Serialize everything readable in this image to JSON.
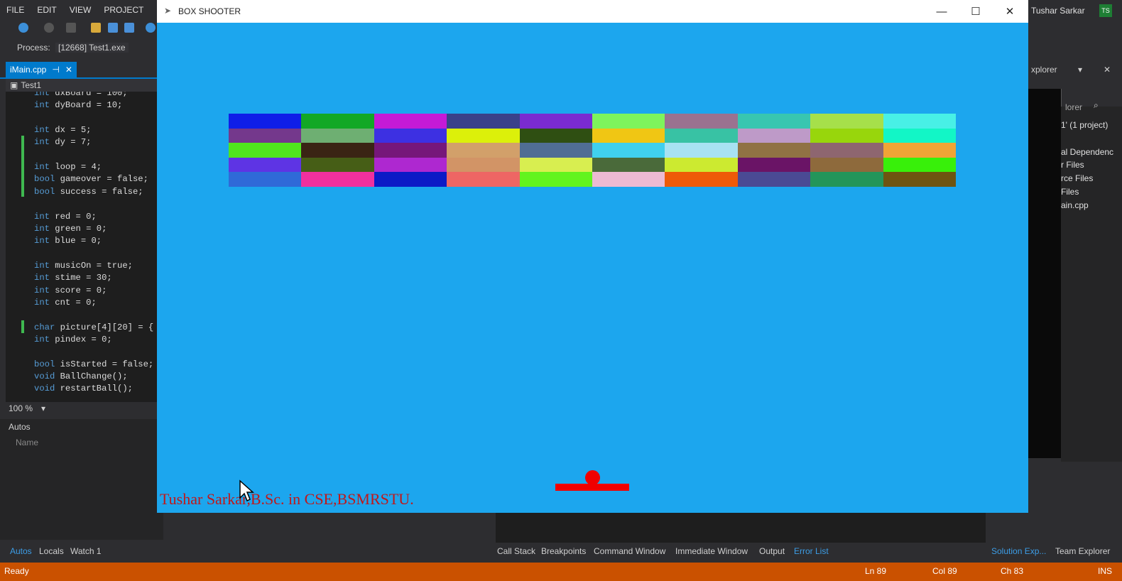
{
  "ide": {
    "menu": [
      "FILE",
      "EDIT",
      "VIEW",
      "PROJECT"
    ],
    "process_label": "Process:",
    "process_value": "[12668] Test1.exe",
    "tab_label": "iMain.cpp",
    "nav_scope": "Test1",
    "zoom": "100 %",
    "autos_title": "Autos",
    "autos_col": "Name",
    "code": [
      {
        "pre": "int ",
        "rest": "dxBoard = 100;"
      },
      {
        "pre": "int ",
        "rest": "dyBoard = 10;"
      },
      {
        "pre": "",
        "rest": ""
      },
      {
        "pre": "int ",
        "rest": "dx = 5;"
      },
      {
        "pre": "int ",
        "rest": "dy = 7;"
      },
      {
        "pre": "",
        "rest": ""
      },
      {
        "pre": "int ",
        "rest": "loop = 4;"
      },
      {
        "pre": "bool ",
        "rest": "gameover = false;"
      },
      {
        "pre": "bool ",
        "rest": "success = false;"
      },
      {
        "pre": "",
        "rest": ""
      },
      {
        "pre": "int ",
        "rest": "red = 0;"
      },
      {
        "pre": "int ",
        "rest": "green = 0;"
      },
      {
        "pre": "int ",
        "rest": "blue = 0;"
      },
      {
        "pre": "",
        "rest": ""
      },
      {
        "pre": "int ",
        "rest": "musicOn = true;"
      },
      {
        "pre": "int ",
        "rest": "stime = 30;"
      },
      {
        "pre": "int ",
        "rest": "score = 0;"
      },
      {
        "pre": "int ",
        "rest": "cnt = 0;"
      },
      {
        "pre": "",
        "rest": ""
      },
      {
        "pre": "char ",
        "rest": "picture[4][20] = {"
      },
      {
        "pre": "int ",
        "rest": "pindex = 0;"
      },
      {
        "pre": "",
        "rest": ""
      },
      {
        "pre": "bool ",
        "rest": "isStarted = false;"
      },
      {
        "pre": "void ",
        "rest": "BallChange();"
      },
      {
        "pre": "void ",
        "rest": "restartBall();"
      }
    ],
    "bottom_tabs_left": [
      "Autos",
      "Locals",
      "Watch 1"
    ],
    "bottom_tabs_right": [
      "Call Stack",
      "Breakpoints",
      "Command Window",
      "Immediate Window",
      "Output",
      "Error List"
    ],
    "bottom_tabs_far": [
      "Solution Exp...",
      "Team Explorer"
    ],
    "user_name": "Tushar Sarkar",
    "avatar": "TS",
    "se_title": "xplorer",
    "se_search": "lorer",
    "se_items": [
      "1' (1 project)",
      "al Dependenc",
      "r Files",
      "rce Files",
      "Files",
      "ain.cpp"
    ],
    "status": {
      "ready": "Ready",
      "ln": "Ln 89",
      "col": "Col 89",
      "ch": "Ch 83",
      "ins": "INS"
    }
  },
  "game": {
    "title": "BOX SHOOTER",
    "credit": "Tushar Sarkar,B.Sc. in CSE,BSMRSTU.",
    "background": "#1ca6ee",
    "paddle_color": "#f00000",
    "ball_color": "#f00000",
    "credit_color": "#c0181a",
    "brick_rows": [
      [
        "#0f1ee8",
        "#12a826",
        "#c51ad6",
        "#3a418a",
        "#7a2bd0",
        "#7ef45c",
        "#9a7290",
        "#38c6b0",
        "#a6e04a",
        "#48f0e6"
      ],
      [
        "#74388c",
        "#6eaf72",
        "#3d30e2",
        "#dcf00a",
        "#2f4f12",
        "#f0c614",
        "#38c2a4",
        "#be9ac8",
        "#98d60c",
        "#12f6c6"
      ],
      [
        "#50e61e",
        "#3a2414",
        "#76177a",
        "#d2a06a",
        "#506e94",
        "#40d0ee",
        "#a8e2f2",
        "#907244",
        "#8e6670",
        "#f0a436"
      ],
      [
        "#5e34e4",
        "#465e16",
        "#ae28d0",
        "#d29466",
        "#d8ee50",
        "#4a6a3a",
        "#ccea30",
        "#6a1466",
        "#8e6a3c",
        "#38f00a"
      ],
      [
        "#2f6ad8",
        "#f0309e",
        "#0c1ac6",
        "#ee6664",
        "#62f41e",
        "#ecbad2",
        "#ee5a08",
        "#4a4a94",
        "#23955a",
        "#6e5410"
      ]
    ]
  }
}
